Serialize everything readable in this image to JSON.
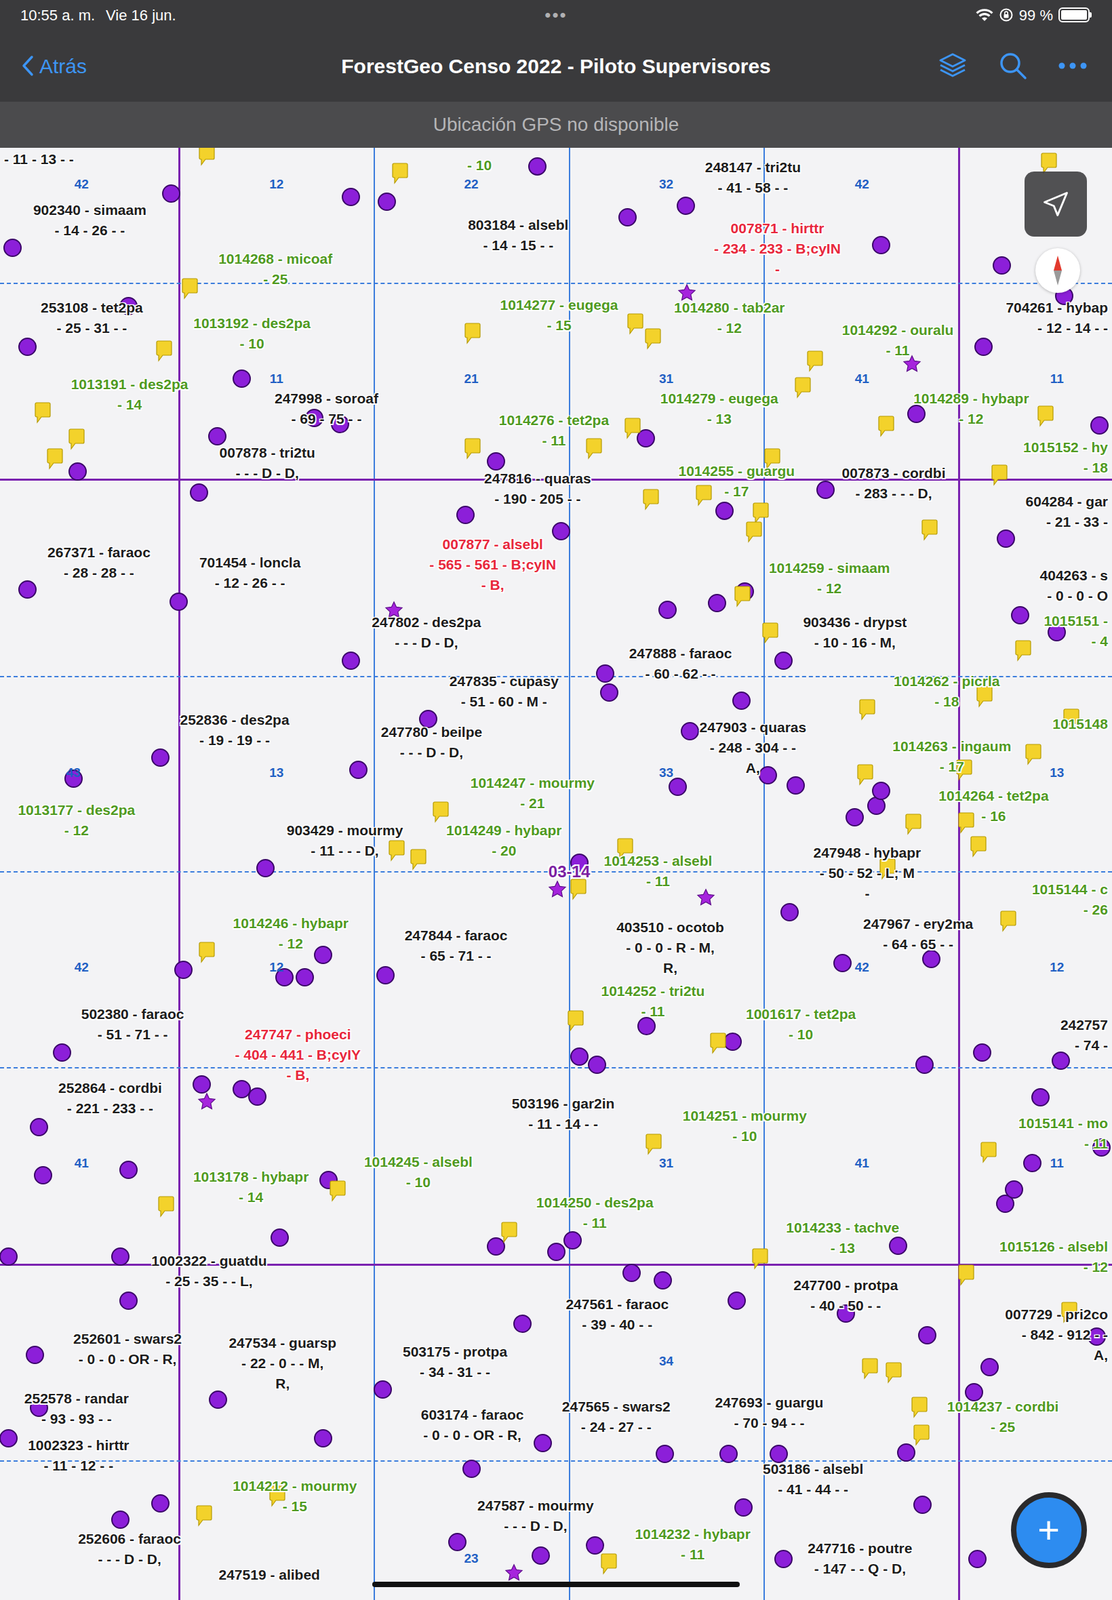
{
  "status_bar": {
    "time": "10:55 a. m.",
    "date": "Vie 16 jun.",
    "dots": "•••",
    "battery": "99 %",
    "battery_level": 0.99
  },
  "nav": {
    "back": "Atrás",
    "title": "ForestGeo Censo 2022 - Piloto Supervisores"
  },
  "banner": "Ubicación GPS no disponible",
  "map": {
    "quadrat_label": "03-14",
    "subquadrats": [
      "42",
      "12",
      "22",
      "32",
      "42",
      "11",
      "21",
      "31",
      "41",
      "11",
      "43",
      "13",
      "33",
      "13",
      "42",
      "12",
      "42",
      "12",
      "41",
      "31",
      "41",
      "11",
      "34",
      "23"
    ],
    "labels": [
      {
        "lines": [
          "- 11 - 13 - -"
        ],
        "color": "#1c1c1c"
      },
      {
        "lines": [
          "- 10"
        ],
        "color": "#4f9a1f"
      },
      {
        "lines": [
          "248147 - tri2tu",
          "- 41 - 58 - -"
        ],
        "color": "#1c1c1c"
      },
      {
        "lines": [
          "007871 - hirttr",
          "- 234 - 233 - B;cyIN",
          "-"
        ],
        "color": "#e8273c"
      },
      {
        "lines": [
          "902340 - simaam",
          "- 14 - 26 - -"
        ],
        "color": "#1c1c1c"
      },
      {
        "lines": [
          "803184 - alsebl",
          "- 14 - 15 - -"
        ],
        "color": "#1c1c1c"
      },
      {
        "lines": [
          "1014268 - micoaf",
          "- 25"
        ],
        "color": "#4f9a1f"
      },
      {
        "lines": [
          "253108 - tet2pa",
          "- 25 - 31 - -"
        ],
        "color": "#1c1c1c"
      },
      {
        "lines": [
          "1013192 - des2pa",
          "- 10"
        ],
        "color": "#4f9a1f"
      },
      {
        "lines": [
          "1014277 - eugega",
          "- 15"
        ],
        "color": "#4f9a1f"
      },
      {
        "lines": [
          "1014280 - tab2ar",
          "- 12"
        ],
        "color": "#4f9a1f"
      },
      {
        "lines": [
          "704261 - hybap",
          "- 12 - 14 - -"
        ],
        "color": "#1c1c1c"
      },
      {
        "lines": [
          "1014292 - ouralu",
          "- 11"
        ],
        "color": "#4f9a1f"
      },
      {
        "lines": [
          "1013191 - des2pa",
          "- 14"
        ],
        "color": "#4f9a1f"
      },
      {
        "lines": [
          "247998 - soroaf",
          "- 69 - 75 - -"
        ],
        "color": "#1c1c1c"
      },
      {
        "lines": [
          "1014279 - eugega",
          "- 13"
        ],
        "color": "#4f9a1f"
      },
      {
        "lines": [
          "1014289 - hybapr",
          "- 12"
        ],
        "color": "#4f9a1f"
      },
      {
        "lines": [
          "1014276 - tet2pa",
          "- 11"
        ],
        "color": "#4f9a1f"
      },
      {
        "lines": [
          "007878 - tri2tu",
          "- - - D - D,"
        ],
        "color": "#1c1c1c"
      },
      {
        "lines": [
          "1015152 - hy",
          "- 18"
        ],
        "color": "#4f9a1f"
      },
      {
        "lines": [
          "247816 - quaras",
          "- 190 - 205 - -"
        ],
        "color": "#1c1c1c"
      },
      {
        "lines": [
          "1014255 - guargu",
          "- 17"
        ],
        "color": "#4f9a1f"
      },
      {
        "lines": [
          "007873 - cordbi",
          "- 283 - - - D,"
        ],
        "color": "#1c1c1c"
      },
      {
        "lines": [
          "604284 - gar",
          "- 21 - 33 -"
        ],
        "color": "#1c1c1c"
      },
      {
        "lines": [
          "267371 - faraoc",
          "- 28 - 28 - -"
        ],
        "color": "#1c1c1c"
      },
      {
        "lines": [
          "701454 - loncla",
          "- 12 - 26 - -"
        ],
        "color": "#1c1c1c"
      },
      {
        "lines": [
          "007877 - alsebl",
          "- 565 - 561 - B;cyIN",
          "- B,"
        ],
        "color": "#e8273c"
      },
      {
        "lines": [
          "1014259 - simaam",
          "- 12"
        ],
        "color": "#4f9a1f"
      },
      {
        "lines": [
          "404263 - s",
          "- 0 - 0 - O"
        ],
        "color": "#1c1c1c"
      },
      {
        "lines": [
          "1015151 -",
          "- 4"
        ],
        "color": "#4f9a1f"
      },
      {
        "lines": [
          "247802 - des2pa",
          "- - - D - D,"
        ],
        "color": "#1c1c1c"
      },
      {
        "lines": [
          "903436 - drypst",
          "- 10 - 16 - M,"
        ],
        "color": "#1c1c1c"
      },
      {
        "lines": [
          "247888 - faraoc",
          "- 60 - 62 - -"
        ],
        "color": "#1c1c1c"
      },
      {
        "lines": [
          "247835 - cupasy",
          "- 51 - 60 - M -"
        ],
        "color": "#1c1c1c"
      },
      {
        "lines": [
          "1014262 - picrla",
          "- 18"
        ],
        "color": "#4f9a1f"
      },
      {
        "lines": [
          "1015148"
        ],
        "color": "#4f9a1f"
      },
      {
        "lines": [
          "252836 - des2pa",
          "- 19 - 19 - -"
        ],
        "color": "#1c1c1c"
      },
      {
        "lines": [
          "247780 - beilpe",
          "- - - D - D,"
        ],
        "color": "#1c1c1c"
      },
      {
        "lines": [
          "247903 - quaras",
          "- 248 - 304 - -",
          "A,"
        ],
        "color": "#1c1c1c"
      },
      {
        "lines": [
          "1014263 - ingaum",
          "- 17"
        ],
        "color": "#4f9a1f"
      },
      {
        "lines": [
          "1014247 - mourmy",
          "- 21"
        ],
        "color": "#4f9a1f"
      },
      {
        "lines": [
          "1014264 - tet2pa",
          "- 16"
        ],
        "color": "#4f9a1f"
      },
      {
        "lines": [
          "1013177 - des2pa",
          "- 12"
        ],
        "color": "#4f9a1f"
      },
      {
        "lines": [
          "903429 - mourmy",
          "- 11 - - - D,"
        ],
        "color": "#1c1c1c"
      },
      {
        "lines": [
          "1014249 - hybapr",
          "- 20"
        ],
        "color": "#4f9a1f"
      },
      {
        "lines": [
          "1014253 - alsebl",
          "- 11"
        ],
        "color": "#4f9a1f"
      },
      {
        "lines": [
          "247948 - hybapr",
          "- 50 - 52 - L; M",
          "-"
        ],
        "color": "#1c1c1c"
      },
      {
        "lines": [
          "1015144 - c",
          "- 26"
        ],
        "color": "#4f9a1f"
      },
      {
        "lines": [
          "1014246 - hybapr",
          "- 12"
        ],
        "color": "#4f9a1f"
      },
      {
        "lines": [
          "247844 - faraoc",
          "- 65 - 71 - -"
        ],
        "color": "#1c1c1c"
      },
      {
        "lines": [
          "403510 - ocotob",
          "- 0 - 0 - R - M,",
          "R,"
        ],
        "color": "#1c1c1c"
      },
      {
        "lines": [
          "247967 - ery2ma",
          "- 64 - 65 - -"
        ],
        "color": "#1c1c1c"
      },
      {
        "lines": [
          "1014252 - tri2tu",
          "- 11"
        ],
        "color": "#4f9a1f"
      },
      {
        "lines": [
          "1001617 - tet2pa",
          "- 10"
        ],
        "color": "#4f9a1f"
      },
      {
        "lines": [
          "242757",
          "- 74 -"
        ],
        "color": "#1c1c1c"
      },
      {
        "lines": [
          "502380 - faraoc",
          "- 51 - 71 - -"
        ],
        "color": "#1c1c1c"
      },
      {
        "lines": [
          "247747 - phoeci",
          "- 404 - 441 - B;cyIY",
          "- B,"
        ],
        "color": "#e8273c"
      },
      {
        "lines": [
          "252864 - cordbi",
          "- 221 - 233 - -"
        ],
        "color": "#1c1c1c"
      },
      {
        "lines": [
          "503196 - gar2in",
          "- 11 - 14 - -"
        ],
        "color": "#1c1c1c"
      },
      {
        "lines": [
          "1014251 - mourmy",
          "- 10"
        ],
        "color": "#4f9a1f"
      },
      {
        "lines": [
          "1015141 - mo",
          "- 11"
        ],
        "color": "#4f9a1f"
      },
      {
        "lines": [
          "1014245 - alsebl",
          "- 10"
        ],
        "color": "#4f9a1f"
      },
      {
        "lines": [
          "1013178 - hybapr",
          "- 14"
        ],
        "color": "#4f9a1f"
      },
      {
        "lines": [
          "1014250 - des2pa",
          "- 11"
        ],
        "color": "#4f9a1f"
      },
      {
        "lines": [
          "1014233 - tachve",
          "- 13"
        ],
        "color": "#4f9a1f"
      },
      {
        "lines": [
          "1015126 - alsebl",
          "- 12"
        ],
        "color": "#4f9a1f"
      },
      {
        "lines": [
          "1002322 - guatdu",
          "- 25 - 35 - - L,"
        ],
        "color": "#1c1c1c"
      },
      {
        "lines": [
          "247700 - protpa",
          "- 40 - 50 - -"
        ],
        "color": "#1c1c1c"
      },
      {
        "lines": [
          "247561 - faraoc",
          "- 39 - 40 - -"
        ],
        "color": "#1c1c1c"
      },
      {
        "lines": [
          "007729 - pri2co",
          "- 842 - 912 - -",
          "A,"
        ],
        "color": "#1c1c1c"
      },
      {
        "lines": [
          "252601 - swars2",
          "- 0 - 0 - OR - R,"
        ],
        "color": "#1c1c1c"
      },
      {
        "lines": [
          "247534 - guarsp",
          "- 22 - 0 - - M,",
          "R,"
        ],
        "color": "#1c1c1c"
      },
      {
        "lines": [
          "503175 - protpa",
          "- 34 - 31 - -"
        ],
        "color": "#1c1c1c"
      },
      {
        "lines": [
          "252578 - randar",
          "- 93 - 93 - -"
        ],
        "color": "#1c1c1c"
      },
      {
        "lines": [
          "247565 - swars2",
          "- 24 - 27 - -"
        ],
        "color": "#1c1c1c"
      },
      {
        "lines": [
          "603174 - faraoc",
          "- 0 - 0 - OR - R,"
        ],
        "color": "#1c1c1c"
      },
      {
        "lines": [
          "247693 - guargu",
          "- 70 - 94 - -"
        ],
        "color": "#1c1c1c"
      },
      {
        "lines": [
          "1014237 - cordbi",
          "- 25"
        ],
        "color": "#4f9a1f"
      },
      {
        "lines": [
          "1002323 - hirttr",
          "- 11 - 12 - -"
        ],
        "color": "#1c1c1c"
      },
      {
        "lines": [
          "503186 - alsebl",
          "- 41 - 44 - -"
        ],
        "color": "#1c1c1c"
      },
      {
        "lines": [
          "1014212 - mourmy",
          "- 15"
        ],
        "color": "#4f9a1f"
      },
      {
        "lines": [
          "247587 - mourmy",
          "- - - D - D,"
        ],
        "color": "#1c1c1c"
      },
      {
        "lines": [
          "252606 - faraoc",
          "- - - D - D,"
        ],
        "color": "#1c1c1c"
      },
      {
        "lines": [
          "1014232 - hybapr",
          "- 11"
        ],
        "color": "#4f9a1f"
      },
      {
        "lines": [
          "247716 - poutre",
          "- 147 - - Q - D,"
        ],
        "color": "#1c1c1c"
      },
      {
        "lines": [
          "247519 - alibed"
        ],
        "color": "#1c1c1c"
      }
    ]
  },
  "fab": "+"
}
